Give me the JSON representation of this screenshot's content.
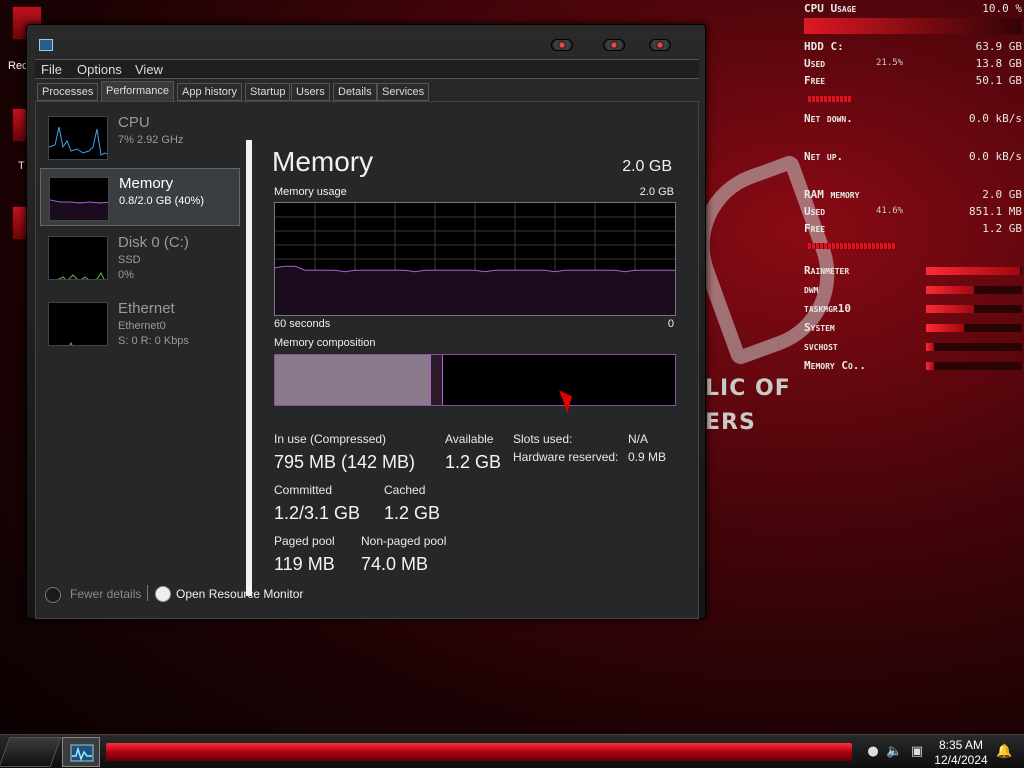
{
  "desktop": {
    "icon_labels": [
      "Rec",
      "T"
    ],
    "wallpaper_text": [
      "LIC OF",
      "ERS"
    ]
  },
  "rainmeter": {
    "cpu": {
      "label": "CPU Usage",
      "value": "10.0 %"
    },
    "hdd": {
      "label": "HDD C:",
      "value": "63.9 GB",
      "used_label": "Used",
      "used_pct": "21.5%",
      "used_value": "13.8 GB",
      "free_label": "Free",
      "free_value": "50.1 GB"
    },
    "net_down": {
      "label": "Net down.",
      "value": "0.0 kB/s"
    },
    "net_up": {
      "label": "Net up.",
      "value": "0.0 kB/s"
    },
    "ram": {
      "label": "RAM memory",
      "value": "2.0 GB",
      "used_label": "Used",
      "used_pct": "41.6%",
      "used_value": "851.1 MB",
      "free_label": "Free",
      "free_value": "1.2 GB"
    },
    "processes": [
      {
        "name": "Rainmeter",
        "level": 0.98
      },
      {
        "name": "dwm",
        "level": 0.5
      },
      {
        "name": "taskmgr10",
        "level": 0.5
      },
      {
        "name": "System",
        "level": 0.4
      },
      {
        "name": "svchost",
        "level": 0.08
      },
      {
        "name": "Memory Co..",
        "level": 0.08
      }
    ],
    "accent": "#e2101d"
  },
  "taskmanager": {
    "menu": [
      "File",
      "Options",
      "View"
    ],
    "tabs": [
      "Processes",
      "Performance",
      "App history",
      "Startup",
      "Users",
      "Details",
      "Services"
    ],
    "active_tab": "Performance",
    "sidebar": [
      {
        "title": "CPU",
        "sub1": "7% 2.92 GHz",
        "sub2": ""
      },
      {
        "title": "Memory",
        "sub1": "0.8/2.0 GB (40%)",
        "sub2": ""
      },
      {
        "title": "Disk 0 (C:)",
        "sub1": "SSD",
        "sub2": "0%"
      },
      {
        "title": "Ethernet",
        "sub1": "Ethernet0",
        "sub2": "S: 0 R: 0 Kbps"
      }
    ],
    "memory": {
      "title": "Memory",
      "total": "2.0 GB",
      "usage_label": "Memory usage",
      "usage_max": "2.0 GB",
      "axis_left": "60 seconds",
      "axis_right": "0",
      "composition_label": "Memory composition",
      "composition_in_use_fraction": 0.39,
      "composition_modified_fraction": 0.03,
      "usage_fraction": 0.4,
      "stats": {
        "in_use_label": "In use (Compressed)",
        "in_use_value": "795 MB (142 MB)",
        "available_label": "Available",
        "available_value": "1.2 GB",
        "committed_label": "Committed",
        "committed_value": "1.2/3.1 GB",
        "cached_label": "Cached",
        "cached_value": "1.2 GB",
        "paged_label": "Paged pool",
        "paged_value": "119 MB",
        "nonpaged_label": "Non-paged pool",
        "nonpaged_value": "74.0 MB",
        "slots_label": "Slots used:",
        "slots_value": "N/A",
        "hw_label": "Hardware reserved:",
        "hw_value": "0.9 MB"
      }
    },
    "footer": {
      "fewer_details": "Fewer details",
      "resource_monitor": "Open Resource Monitor"
    }
  },
  "taskbar": {
    "time": "8:35 AM",
    "date": "12/4/2024"
  }
}
